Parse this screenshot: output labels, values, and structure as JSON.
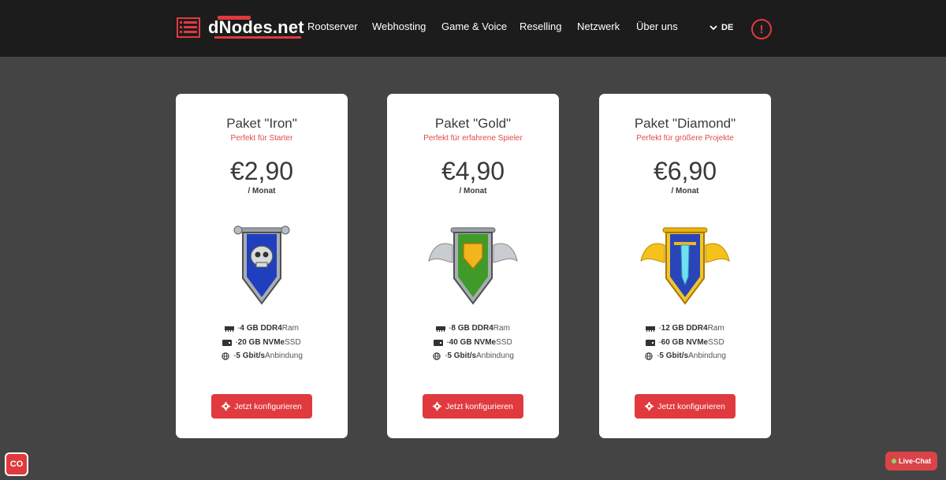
{
  "header": {
    "logo_text": "dNodes.net",
    "nav": [
      "Rootserver",
      "Webhosting",
      "Game & Voice",
      "Reselling",
      "Netzwerk",
      "Über uns"
    ],
    "lang": "DE",
    "alert_symbol": "!"
  },
  "cards": [
    {
      "title": "Paket \"Iron\"",
      "subtitle": "Perfekt für Starter",
      "price": "€2,90",
      "period": "/ Monat",
      "emblem": "iron-banner",
      "specs": [
        {
          "icon": "ram-icon",
          "prefix": "- ",
          "value": "4 GB DDR4",
          "suffix": " Ram"
        },
        {
          "icon": "drive-icon",
          "prefix": "- ",
          "value": "20 GB NVMe",
          "suffix": " SSD"
        },
        {
          "icon": "globe-icon",
          "prefix": "- ",
          "value": "5 Gbit/s",
          "suffix": " Anbindung"
        }
      ],
      "button": "Jetzt konfigurieren"
    },
    {
      "title": "Paket \"Gold\"",
      "subtitle": "Perfekt für erfahrene Spieler",
      "price": "€4,90",
      "period": "/ Monat",
      "emblem": "gold-banner",
      "specs": [
        {
          "icon": "ram-icon",
          "prefix": "- ",
          "value": "8 GB DDR4",
          "suffix": " Ram"
        },
        {
          "icon": "drive-icon",
          "prefix": "- ",
          "value": "40 GB NVMe",
          "suffix": " SSD"
        },
        {
          "icon": "globe-icon",
          "prefix": "- ",
          "value": "5 Gbit/s",
          "suffix": " Anbindung"
        }
      ],
      "button": "Jetzt konfigurieren"
    },
    {
      "title": "Paket \"Diamond\"",
      "subtitle": "Perfekt für größere Projekte",
      "price": "€6,90",
      "period": "/ Monat",
      "emblem": "diamond-banner",
      "specs": [
        {
          "icon": "ram-icon",
          "prefix": "- ",
          "value": "12 GB DDR4",
          "suffix": " Ram"
        },
        {
          "icon": "drive-icon",
          "prefix": "- ",
          "value": "60 GB NVMe",
          "suffix": " SSD"
        },
        {
          "icon": "globe-icon",
          "prefix": "- ",
          "value": "5 Gbit/s",
          "suffix": " Anbindung"
        }
      ],
      "button": "Jetzt konfigurieren"
    }
  ],
  "widgets": {
    "cookie_label": "CO",
    "livechat_label": "Live-Chat"
  },
  "colors": {
    "accent": "#e03a3e",
    "header_bg": "#1c1c1c",
    "page_bg": "#444444",
    "card_bg": "#ffffff"
  }
}
